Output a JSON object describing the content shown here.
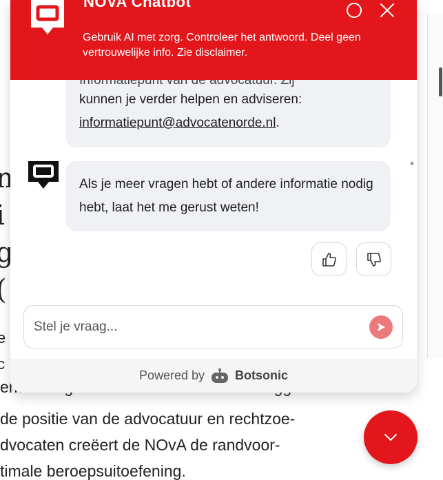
{
  "chat": {
    "title": "NOVA Chatbot",
    "notice": "Gebruik AI met zorg. Controleer het antwoord. Deel geen vertrouwelijke info. Zie disclaimer.",
    "messages": [
      {
        "cut_line": "Informatiepunt van de advocatuur. Zij",
        "line1": "kunnen je verder helpen en adviseren:",
        "email": "informatiepunt@advocatenorde.nl",
        "after_email": "."
      },
      {
        "text": "Als je meer vragen hebt of andere informatie nodig hebt, laat het me gerust weten!"
      }
    ],
    "input_placeholder": "Stel je vraag...",
    "powered_by_prefix": "Powered by",
    "powered_by_brand": "Botsonic",
    "colors": {
      "brand": "#e3161b",
      "send": "#ec7a7b",
      "bubble": "#eff1f5"
    }
  },
  "background": {
    "letters": [
      "n",
      "i",
      "g",
      "("
    ],
    "small_letters": [
      "e",
      "c"
    ],
    "paragraph": [
      "enwoordiger van de advocatuur rechtinggevend",
      "de positie van de advocatuur en rechtzoe-",
      "dvocaten creëert de NOvA de randvoor-",
      "timale beroepsuitoefening."
    ]
  },
  "icons": {
    "logo": "chat-bubble-logo-icon",
    "minimize": "circle-icon",
    "close": "close-icon",
    "thumbs_up": "thumbs-up-icon",
    "thumbs_down": "thumbs-down-icon",
    "send": "send-arrow-icon",
    "botsonic": "botsonic-robot-icon",
    "fab": "chevron-down-icon"
  }
}
